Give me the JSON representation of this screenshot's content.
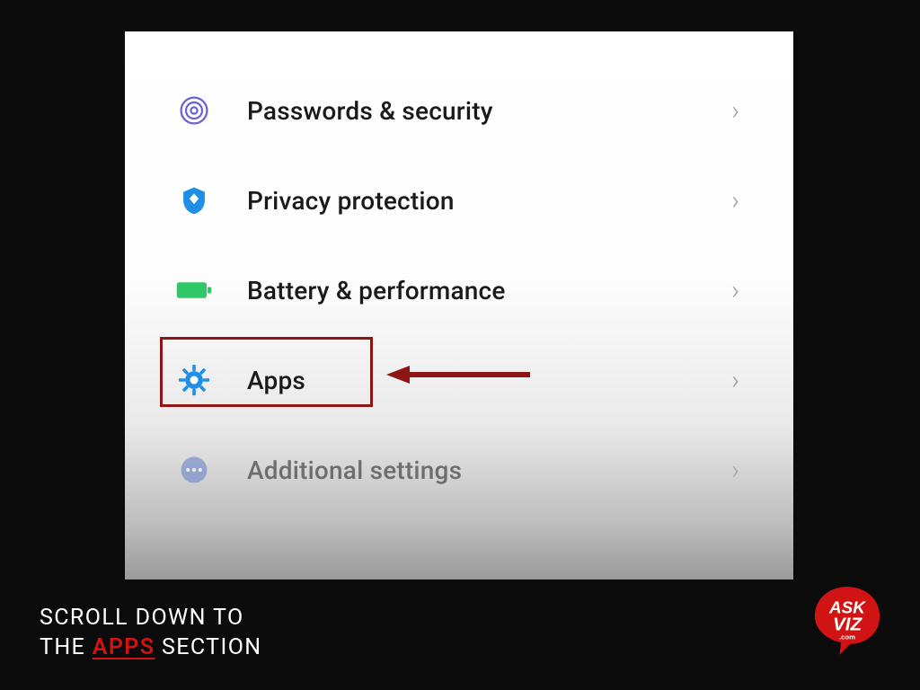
{
  "settings": {
    "items": [
      {
        "id": "passwords-security",
        "label": "Passwords & security",
        "icon": "fingerprint-icon",
        "color": "#6b63d6"
      },
      {
        "id": "privacy-protection",
        "label": "Privacy protection",
        "icon": "shield-icon",
        "color": "#1f8fe6"
      },
      {
        "id": "battery-performance",
        "label": "Battery & performance",
        "icon": "battery-icon",
        "color": "#2fc768"
      },
      {
        "id": "apps",
        "label": "Apps",
        "icon": "gear-icon",
        "color": "#1f8fe6"
      },
      {
        "id": "additional-settings",
        "label": "Additional settings",
        "icon": "dots-icon",
        "color": "#5d7cc9"
      }
    ]
  },
  "annotation": {
    "highlighted_item": "apps",
    "arrow_color": "#8f1414"
  },
  "caption": {
    "line1_a": "SCROLL DOWN TO",
    "line2_a": "THE ",
    "line2_hl": "APPS",
    "line2_b": " SECTION"
  },
  "brand": {
    "name": "ASK VIZ",
    "sub": ".com",
    "bg": "#d01414"
  }
}
